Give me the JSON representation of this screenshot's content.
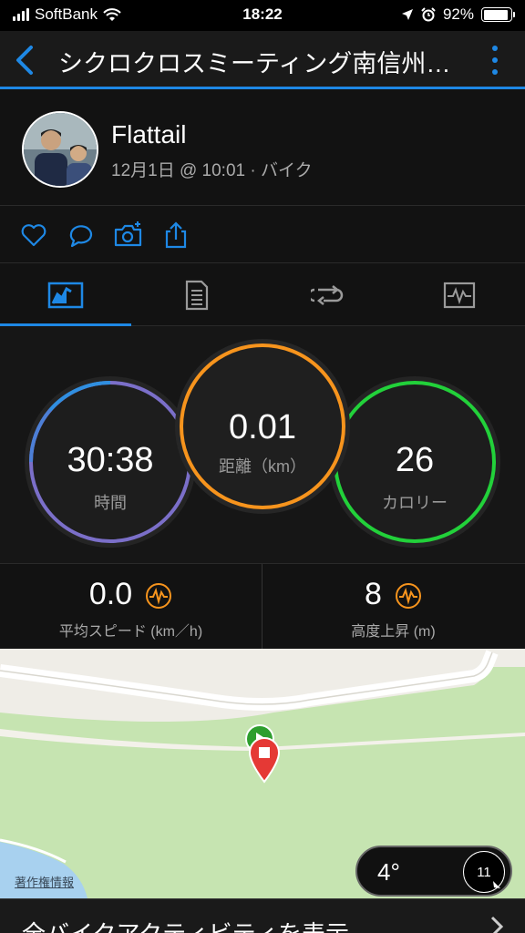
{
  "status": {
    "carrier": "SoftBank",
    "time": "18:22",
    "battery": "92%",
    "battery_level": 0.92
  },
  "nav": {
    "title": "シクロクロスミーティング南信州…"
  },
  "profile": {
    "name": "Flattail",
    "meta": "12月1日 @ 10:01 · バイク"
  },
  "gauges": {
    "time": {
      "value": "30:38",
      "label": "時間"
    },
    "distance": {
      "value": "0.01",
      "label": "距離（km）"
    },
    "calories": {
      "value": "26",
      "label": "カロリー"
    }
  },
  "stats": {
    "speed": {
      "value": "0.0",
      "label": "平均スピード (km／h)"
    },
    "elevation": {
      "value": "8",
      "label": "高度上昇 (m)"
    }
  },
  "map": {
    "credit": "著作権情報",
    "temperature": "4°",
    "wind": "11"
  },
  "footer": {
    "label": "全バイクアクティビティを表示"
  },
  "colors": {
    "accent": "#1e88e5",
    "time_ring": "#7b6fc9",
    "distance_ring": "#f7941d",
    "calories_ring": "#22d13a",
    "stat_icon": "#f7941d",
    "stop_marker": "#e53935",
    "start_marker": "#2e9e2e"
  }
}
